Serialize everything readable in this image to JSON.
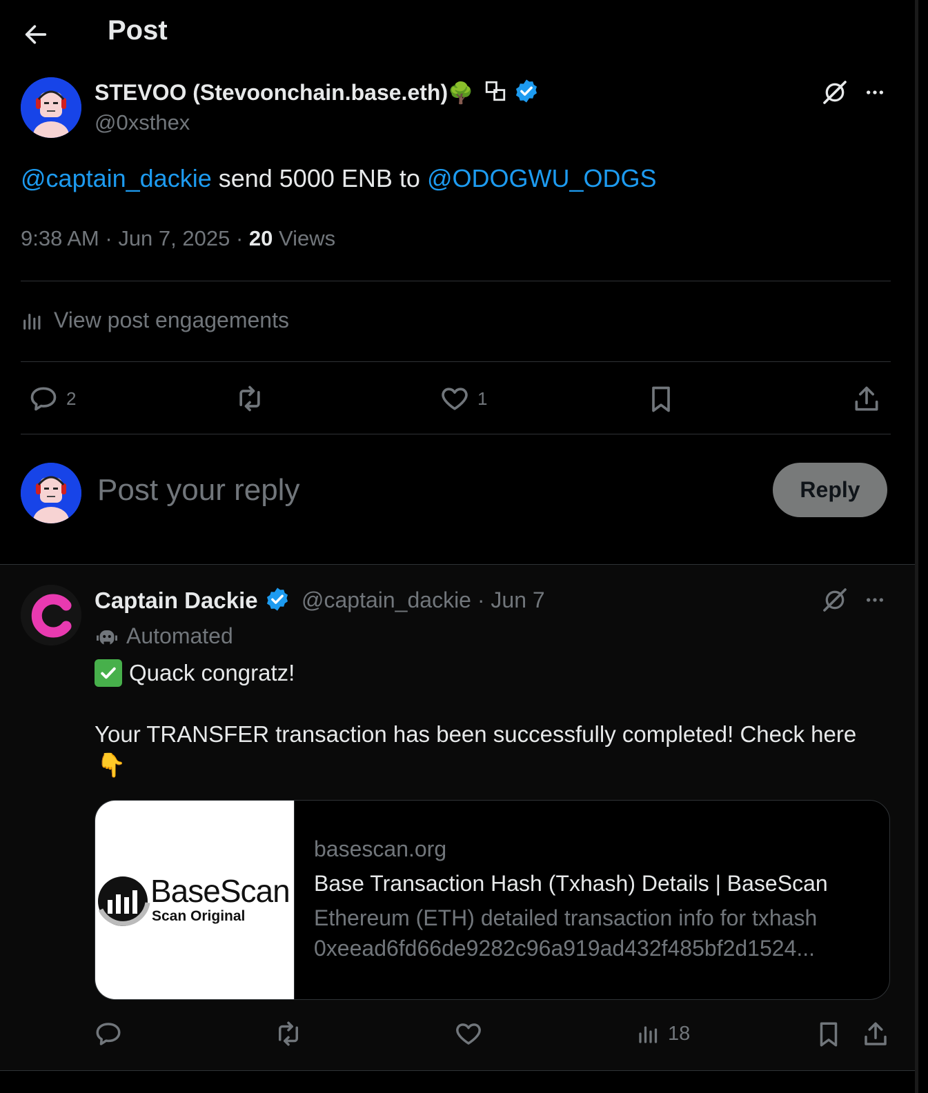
{
  "header": {
    "title": "Post"
  },
  "post": {
    "author_name": "STEVOO (Stevoonchain.base.eth)",
    "author_emoji": "🌳",
    "author_handle": "@0xsthex",
    "text": {
      "mention1": "@captain_dackie",
      "middle": " send 5000 ENB to ",
      "mention2": "@ODOGWU_ODGS"
    },
    "time": "9:38 AM",
    "date": "Jun 7, 2025",
    "views_count": "20",
    "views_label": "Views",
    "engagements_label": "View post engagements",
    "replies": "2",
    "likes": "1"
  },
  "composer": {
    "placeholder": "Post your reply",
    "button_label": "Reply"
  },
  "reply": {
    "author_name": "Captain Dackie",
    "handle": "@captain_dackie",
    "date": "Jun 7",
    "automated_label": "Automated",
    "line1": "Quack congratz!",
    "line2": "Your TRANSFER transaction has been successfully completed! Check here",
    "pointing_emoji": "👇",
    "check_emoji": "✅",
    "card": {
      "image_brand": "BaseScan",
      "image_tagline": "Scan Original",
      "domain": "basescan.org",
      "title": "Base Transaction Hash (Txhash) Details | BaseScan",
      "description_line1": "Ethereum (ETH) detailed transaction info for txhash",
      "description_line2": "0xeead6fd66de9282c96a919ad432f485bf2d1524..."
    },
    "views": "18"
  },
  "colors": {
    "background": "#000000",
    "text": "#e7e9ea",
    "muted": "#71767b",
    "link": "#1d9bf0",
    "verified": "#1d9bf0",
    "divider": "#2f3336",
    "reply_button": "#787a7a",
    "avatar_blue": "#1744e8",
    "dackie_pink": "#e83ab0"
  },
  "icons": [
    "back-arrow-icon",
    "verified-badge-icon",
    "grok-icon",
    "more-icon",
    "bar-chart-icon",
    "reply-icon",
    "repost-icon",
    "like-icon",
    "bookmark-icon",
    "share-icon",
    "bot-icon"
  ]
}
